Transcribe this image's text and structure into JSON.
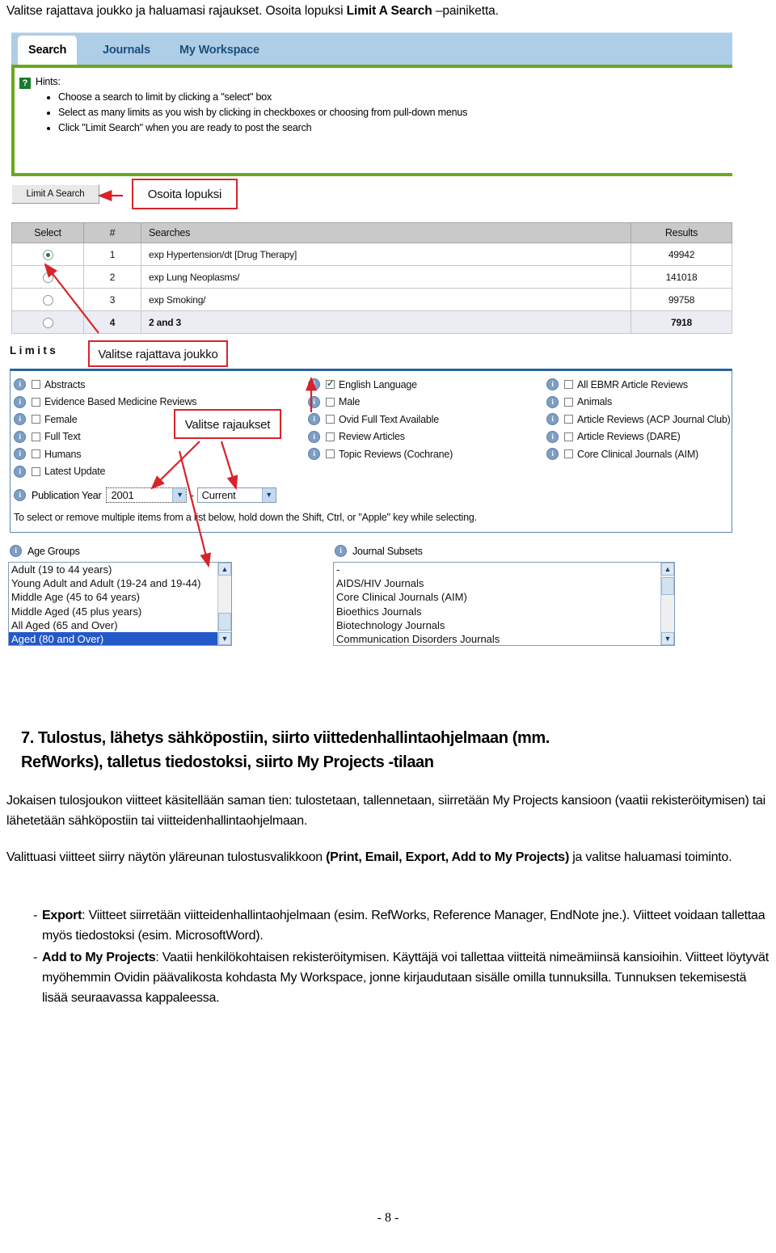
{
  "top_caption": {
    "before": "Valitse rajattava joukko ja haluamasi rajaukset. Osoita lopuksi ",
    "bold": "Limit A Search",
    "after": " –painiketta."
  },
  "screenshot": {
    "tabs": [
      {
        "label": "Search",
        "active": true
      },
      {
        "label": "Journals",
        "active": false
      },
      {
        "label": "My Workspace",
        "active": false
      }
    ],
    "hints": {
      "icon": "question-mark-icon",
      "title": "Hints:",
      "items": [
        "Choose a search to limit by clicking a \"select\" box",
        "Select as many limits as you wish by clicking in checkboxes or choosing from pull-down menus",
        "Click \"Limit Search\" when you are ready to post the search"
      ]
    },
    "limit_button": "Limit A Search",
    "annotations": {
      "osoita_lopuksi": "Osoita lopuksi",
      "valitse_joukko": "Valitse rajattava joukko",
      "valitse_rajaukset": "Valitse rajaukset"
    },
    "results_table": {
      "columns": [
        "Select",
        "#",
        "Searches",
        "Results"
      ],
      "rows": [
        {
          "selected": true,
          "num": "1",
          "search": "exp Hypertension/dt [Drug Therapy]",
          "results": "49942"
        },
        {
          "selected": false,
          "num": "2",
          "search": "exp Lung Neoplasms/",
          "results": "141018"
        },
        {
          "selected": false,
          "num": "3",
          "search": "exp Smoking/",
          "results": "99758"
        },
        {
          "selected": false,
          "num": "4",
          "search": "2 and 3",
          "results": "7918"
        }
      ]
    },
    "limits_heading": "Limits",
    "limits": {
      "column_a": [
        {
          "label": "Abstracts",
          "checked": false
        },
        {
          "label": "Evidence Based Medicine Reviews",
          "checked": false
        },
        {
          "label": "Female",
          "checked": false
        },
        {
          "label": "Full Text",
          "checked": false
        },
        {
          "label": "Humans",
          "checked": false
        },
        {
          "label": "Latest Update",
          "checked": false
        }
      ],
      "column_b": [
        {
          "label": "English Language",
          "checked": true
        },
        {
          "label": "Male",
          "checked": false
        },
        {
          "label": "Ovid Full Text Available",
          "checked": false
        },
        {
          "label": "Review Articles",
          "checked": false
        },
        {
          "label": "Topic Reviews (Cochrane)",
          "checked": false
        }
      ],
      "column_c": [
        {
          "label": "All EBMR Article Reviews",
          "checked": false
        },
        {
          "label": "Animals",
          "checked": false
        },
        {
          "label": "Article Reviews (ACP Journal Club)",
          "checked": false
        },
        {
          "label": "Article Reviews (DARE)",
          "checked": false
        },
        {
          "label": "Core Clinical Journals (AIM)",
          "checked": false
        }
      ]
    },
    "publication_year": {
      "label": "Publication Year",
      "from": "2001",
      "separator": "-",
      "to": "Current"
    },
    "multiselect_note": "To select or remove multiple items from a list below, hold down the Shift, Ctrl, or \"Apple\" key while selecting.",
    "age_groups": {
      "label": "Age Groups",
      "options": [
        {
          "label": "Adult (19 to 44 years)",
          "selected": false
        },
        {
          "label": "Young Adult and Adult (19-24 and 19-44)",
          "selected": false
        },
        {
          "label": "Middle Age (45 to 64 years)",
          "selected": false
        },
        {
          "label": "Middle Aged (45 plus years)",
          "selected": false
        },
        {
          "label": "All Aged (65 and Over)",
          "selected": false
        },
        {
          "label": "Aged (80 and Over)",
          "selected": true
        }
      ]
    },
    "journal_subsets": {
      "label": "Journal Subsets",
      "options": [
        {
          "label": "-",
          "selected": false
        },
        {
          "label": "AIDS/HIV Journals",
          "selected": false
        },
        {
          "label": "Core Clinical Journals (AIM)",
          "selected": false
        },
        {
          "label": "Bioethics Journals",
          "selected": false
        },
        {
          "label": "Biotechnology Journals",
          "selected": false
        },
        {
          "label": "Communication Disorders Journals",
          "selected": false
        }
      ]
    },
    "scroll_arrow_up": "▲",
    "scroll_arrow_down": "▼",
    "select_arrow": "▼"
  },
  "doc": {
    "heading_line1": "7. Tulostus, lähetys sähköpostiin, siirto viittedenhallintaohjelmaan (mm.",
    "heading_line2": "RefWorks), talletus tiedostoksi, siirto My Projects  -tilaan",
    "paragraph1": "Jokaisen tulosjoukon viitteet käsitellään saman tien: tulostetaan, tallennetaan, siirretään My Projects kansioon (vaatii rekisteröitymisen) tai lähetetään sähköpostiin tai viitteidenhallintaohjelmaan.",
    "paragraph2_pre": "Valittuasi viitteet siirry näytön yläreunan tulostusvalikkoon ",
    "paragraph2_bold": "(Print, Email, Export, Add to My Projects)",
    "paragraph2_post": " ja valitse haluamasi toiminto.",
    "bullets": [
      {
        "marker": "-",
        "bold": "Export",
        "text": ": Viitteet siirretään viitteidenhallintaohjelmaan (esim. RefWorks, Reference Manager, EndNote jne.). Viitteet voidaan tallettaa myös tiedostoksi (esim. MicrosoftWord)."
      },
      {
        "marker": "-",
        "bold": "Add to My Projects",
        "text": ": Vaatii henkilökohtaisen rekisteröitymisen. Käyttäjä voi tallettaa viitteitä nimeämiinsä kansioihin. Viitteet löytyvät myöhemmin Ovidin päävalikosta kohdasta My Workspace, jonne kirjaudutaan sisälle omilla tunnuksilla. Tunnuksen tekemisestä lisää seuraavassa kappaleessa."
      }
    ],
    "page_number": "- 8 -"
  },
  "colors": {
    "tab_bar": "#aecde6",
    "green_rule": "#6aa81e",
    "annotation_red": "#d8232a",
    "panel_border": "#2b63a0",
    "selection_blue": "#2358c8",
    "check_green": "#1c7c1c"
  }
}
